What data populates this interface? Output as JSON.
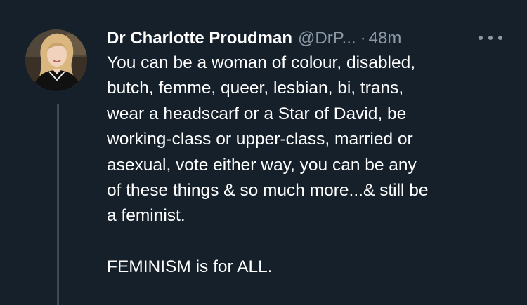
{
  "tweet": {
    "author": {
      "display_name": "Dr Charlotte Proudman",
      "handle": "@DrP...",
      "avatar_icon": "profile-photo"
    },
    "separator": "·",
    "timestamp": "48m",
    "more_icon": "more-horizontal-icon",
    "text_lines": [
      "You can be a woman of colour, disabled,",
      "butch, femme, queer, lesbian, bi, trans,",
      "wear a headscarf or a Star of David, be",
      "working-class or upper-class, married or",
      "asexual, vote either way, you can be any",
      "of these things & so much more...& still be",
      "a feminist.",
      "",
      "FEMINISM is for ALL."
    ]
  },
  "colors": {
    "background": "#15202b",
    "primary_text": "#ffffff",
    "secondary_text": "#8b98a5",
    "thread_line": "#3d4956"
  }
}
